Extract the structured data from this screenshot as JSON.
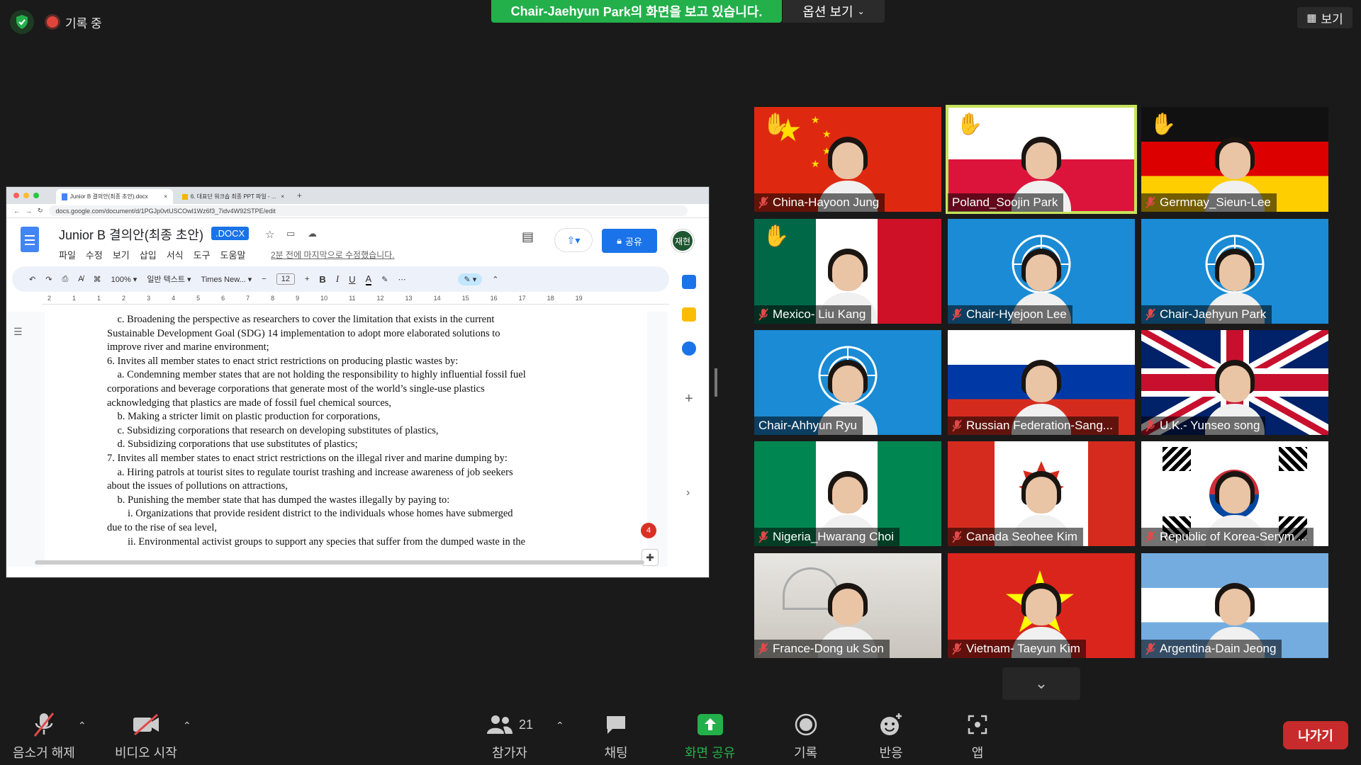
{
  "top": {
    "recording": "기록 중",
    "banner_name": "Chair-Jaehyun",
    "banner_rest": "Park의 화면을 보고 있습니다.",
    "view_options": "옵션 보기",
    "view_button": "보기"
  },
  "browser": {
    "tab1": "Junior B 결의안(최종 초안).docx",
    "tab2": "6. 대표단 워크숍 최종 PPT 파일 - ...",
    "url": "docs.google.com/document/d/1PGJp0vtUSCOwl1Wz6f3_7idv4W92STPE/edit"
  },
  "doc": {
    "title": "Junior B 결의안(최종 초안)",
    "badge": ".DOCX",
    "menus": [
      "파일",
      "수정",
      "보기",
      "삽입",
      "서식",
      "도구",
      "도움말"
    ],
    "last_edit": "2분 전에 마지막으로 수정했습니다.",
    "share": "공유",
    "avatar": "재현",
    "zoom": "100%",
    "style": "일반 텍스트",
    "font": "Times New...",
    "font_size": "12",
    "ruler": [
      "2",
      "1",
      "1",
      "2",
      "3",
      "4",
      "5",
      "6",
      "7",
      "8",
      "9",
      "10",
      "11",
      "12",
      "13",
      "14",
      "15",
      "16",
      "17",
      "18",
      "19"
    ],
    "comment_count": "4",
    "lines": [
      "    c. Broadening the perspective as researchers to cover the limitation that exists in the current",
      "Sustainable Development Goal (SDG) 14 implementation to adopt more elaborated solutions to",
      "improve river and marine environment;",
      "",
      "6. Invites all member states to enact strict restrictions on producing plastic wastes by:",
      "    a. Condemning member states that are not holding the responsibility to highly influential fossil fuel",
      "corporations and beverage corporations that generate most of the world’s single-use plastics",
      "acknowledging that plastics are made of fossil fuel chemical sources,",
      "    b. Making a stricter limit on plastic production for corporations,",
      "    c. Subsidizing corporations that research on developing substitutes of plastics,",
      "    d. Subsidizing corporations that use substitutes of plastics;",
      "",
      "7. Invites all member states to enact strict restrictions on the illegal river and marine dumping by:",
      "    a. Hiring patrols at tourist sites to regulate tourist trashing and increase awareness of job seekers",
      "about the issues of pollutions on attractions,",
      "    b. Punishing the member state that has dumped the wastes illegally by paying to:",
      "        i. Organizations that provide resident district to the individuals whose homes have submerged",
      "due to the rise of sea level,",
      "        ii. Environmental activist groups to support any species that suffer from the dumped waste in the"
    ]
  },
  "participants": [
    {
      "name": "China-Hayoon Jung",
      "flag": "china",
      "hand": true,
      "muted": true
    },
    {
      "name": "Poland_Soojin Park",
      "flag": "poland",
      "hand": true,
      "muted": false,
      "active": true
    },
    {
      "name": "Germnay_Sieun-Lee",
      "flag": "germany",
      "hand": true,
      "muted": true
    },
    {
      "name": "Mexico- Liu Kang",
      "flag": "mexico",
      "hand": true,
      "muted": true
    },
    {
      "name": "Chair-Hyejoon Lee",
      "flag": "un",
      "hand": false,
      "muted": true
    },
    {
      "name": "Chair-Jaehyun Park",
      "flag": "un",
      "hand": false,
      "muted": true
    },
    {
      "name": "Chair-Ahhyun Ryu",
      "flag": "un",
      "hand": false,
      "muted": false
    },
    {
      "name": "Russian Federation-Sang...",
      "flag": "russia",
      "hand": false,
      "muted": true
    },
    {
      "name": "U.K.- Yunseo song",
      "flag": "uk",
      "hand": false,
      "muted": true
    },
    {
      "name": "Nigeria_Hwarang Choi",
      "flag": "nigeria",
      "hand": false,
      "muted": true
    },
    {
      "name": "Canada Seohee Kim",
      "flag": "canada",
      "hand": false,
      "muted": true
    },
    {
      "name": "Republic of Korea-Serym ...",
      "flag": "korea",
      "hand": false,
      "muted": true
    },
    {
      "name": "France-Dong uk Son",
      "flag": "room",
      "hand": false,
      "muted": true
    },
    {
      "name": "Vietnam- Taeyun Kim",
      "flag": "vietnam",
      "hand": false,
      "muted": true
    },
    {
      "name": "Argentina-Dain Jeong",
      "flag": "argentina",
      "hand": false,
      "muted": true
    }
  ],
  "toolbar": {
    "unmute": "음소거 해제",
    "start_video": "비디오 시작",
    "participants": "참가자",
    "participant_count": "21",
    "chat": "채팅",
    "share_screen": "화면 공유",
    "record": "기록",
    "reactions": "반응",
    "apps": "앱",
    "leave": "나가기"
  },
  "colors": {
    "share_green": "#23b04b",
    "active_speaker": "#c6e35b",
    "leave_red": "#c72b2b",
    "docs_blue": "#1a73e8"
  }
}
